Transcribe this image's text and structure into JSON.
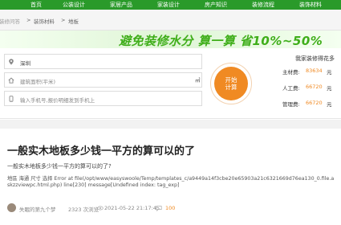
{
  "nav": {
    "items": [
      "首页",
      "公装设计",
      "家居产品",
      "家装设计",
      "房产知识",
      "装修流程",
      "装饰材料"
    ]
  },
  "breadcrumb": {
    "items": [
      "装修问答",
      "装饰材料",
      "地板"
    ]
  },
  "calculator": {
    "slogan": "避免装修水分 算一算 省10%~50%",
    "city": "深圳",
    "area_placeholder": "建筑面积(平米)",
    "area_unit": "㎡",
    "phone_placeholder": "输入手机号,报价明细发到手机上",
    "button": "开始计算",
    "result_title": "我家装修得花多",
    "rows": [
      {
        "label": "主材费:",
        "value": "83634",
        "unit": "元"
      },
      {
        "label": "人工费:",
        "value": "66720",
        "unit": "元"
      },
      {
        "label": "管理费:",
        "value": "66720",
        "unit": "元"
      }
    ],
    "accent_color": "#f08a23",
    "brand_color": "#2a9a2a"
  },
  "article": {
    "title": "一般实木地板多少钱一平方的算可以的了",
    "subtitle": "一般实木地板多少钱一平方的算可以的了?",
    "error_text": "地區 海通 尺寸 选择 Error at file(/opt/www/easyswoole/Temp/templates_c/a9449a14f3cbe20e65903a21c6321669d76ea130_0.file.askzzviewpc.html.php) line[230] message[Undefined index: tag_exp]",
    "author": "失眠的第九个梦",
    "views": "2323 次浏览",
    "date": "2021-05-22 21:17:45",
    "answer_label": "答",
    "answer_count": "100"
  }
}
